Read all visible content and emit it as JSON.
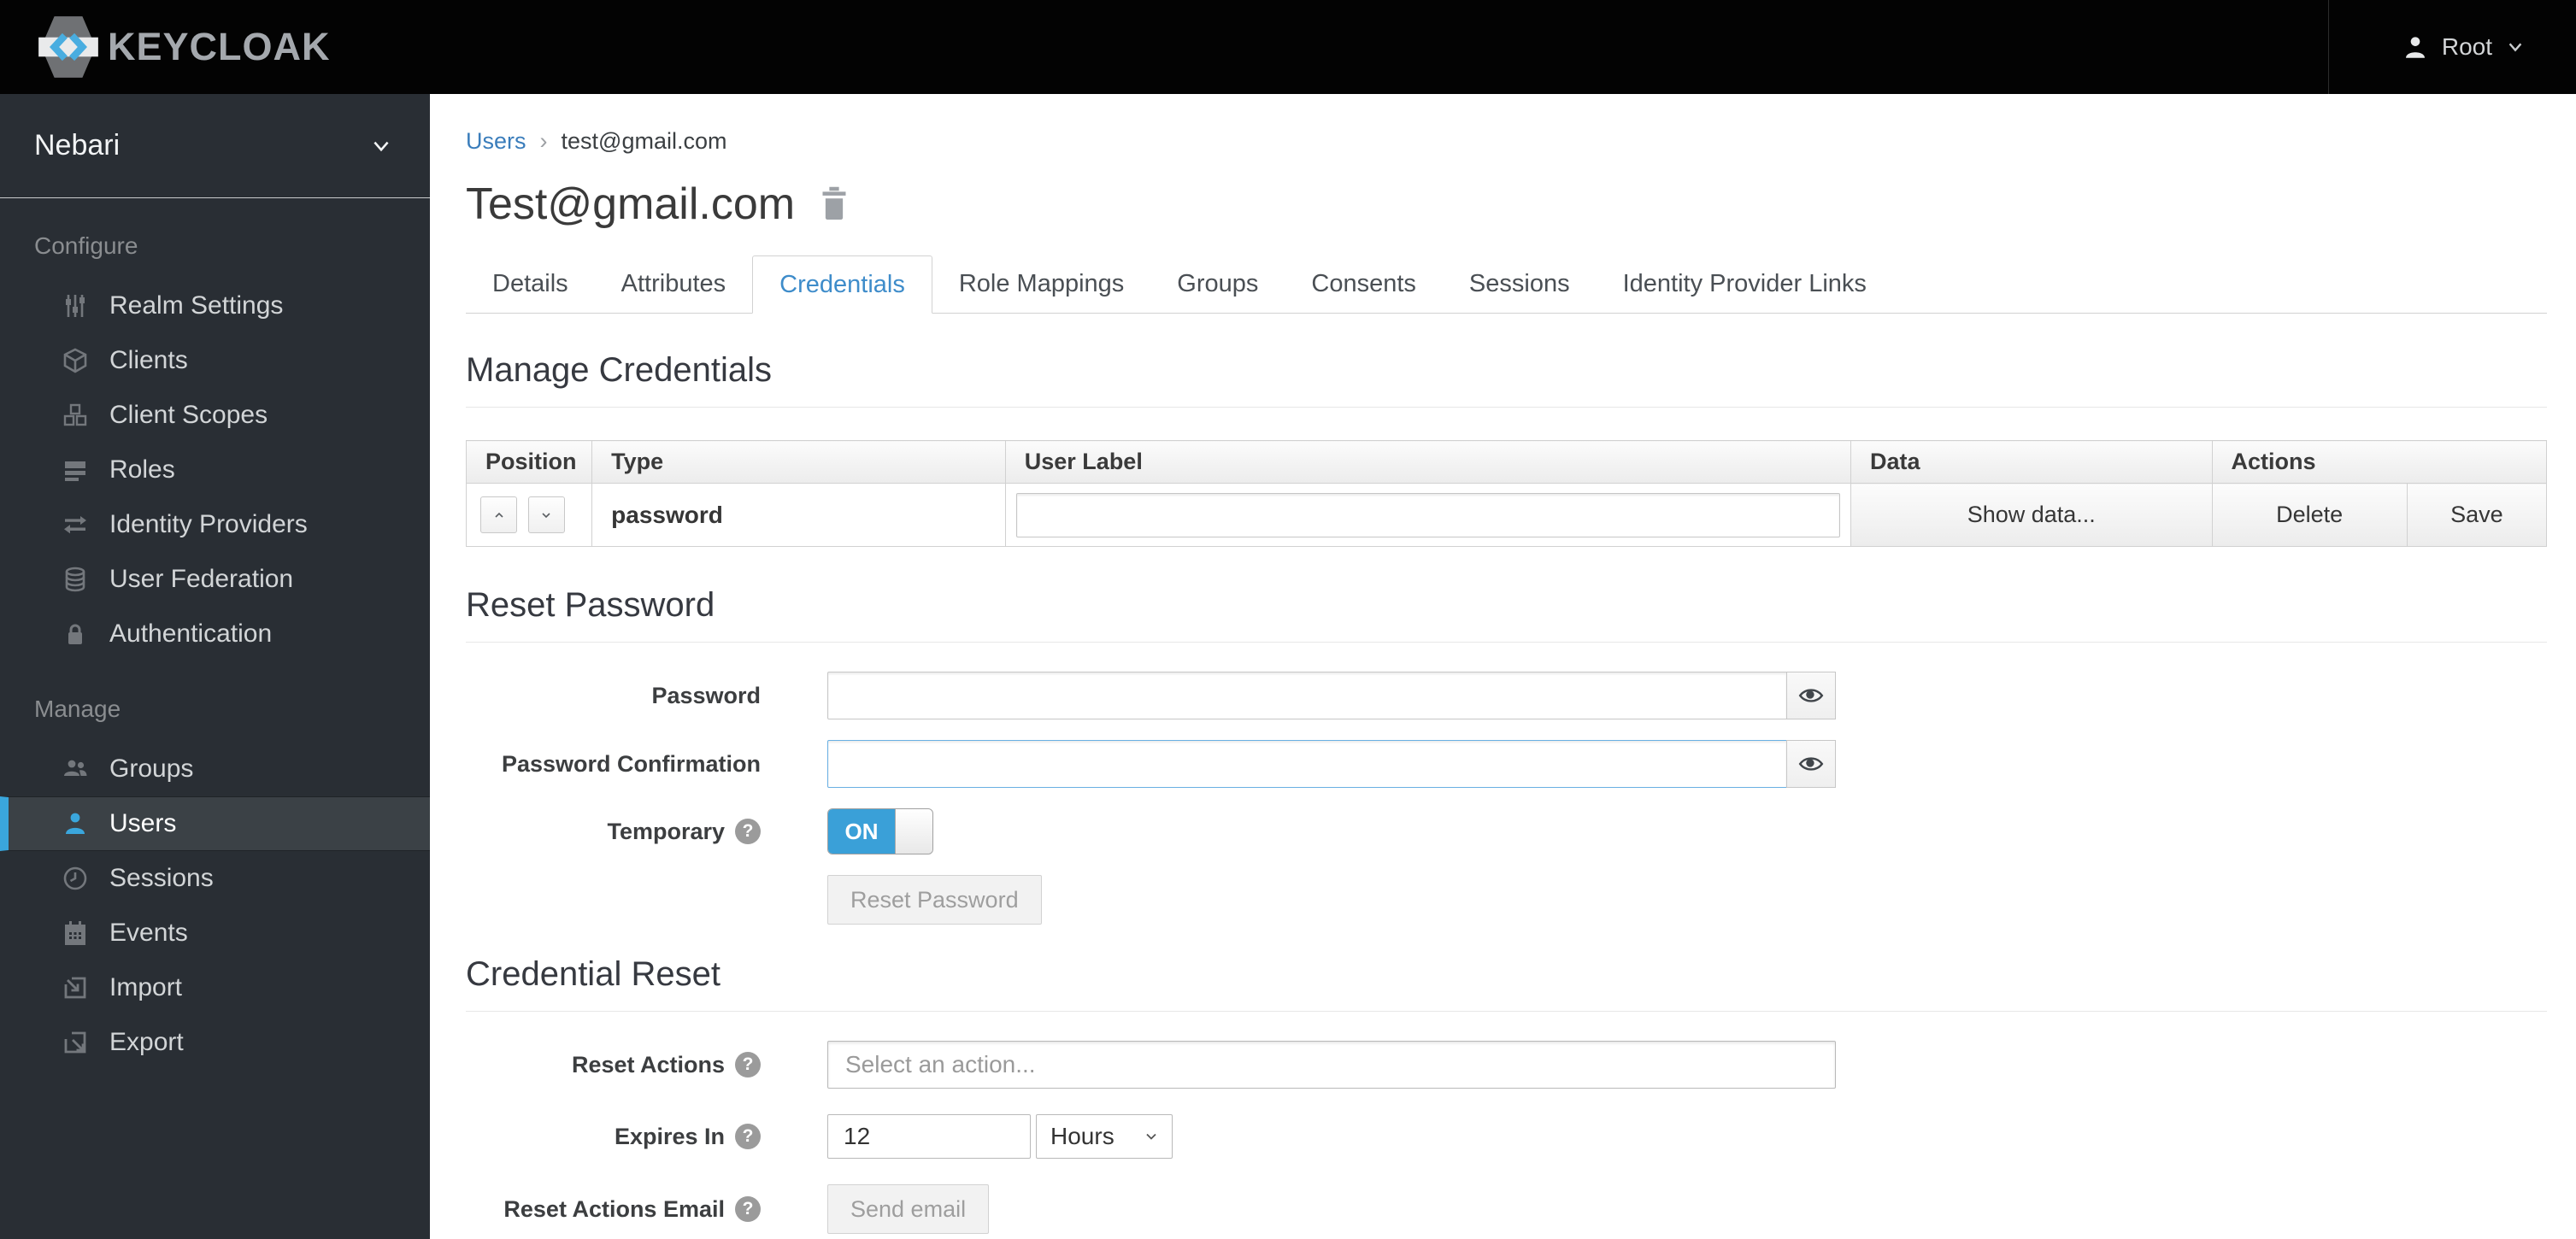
{
  "header": {
    "brand": "KEYCLOAK",
    "user": "Root"
  },
  "sidebar": {
    "realm": "Nebari",
    "sections": [
      {
        "label": "Configure",
        "items": [
          {
            "label": "Realm Settings",
            "icon": "sliders-icon"
          },
          {
            "label": "Clients",
            "icon": "cube-icon"
          },
          {
            "label": "Client Scopes",
            "icon": "cubes-icon"
          },
          {
            "label": "Roles",
            "icon": "list-icon"
          },
          {
            "label": "Identity Providers",
            "icon": "exchange-icon"
          },
          {
            "label": "User Federation",
            "icon": "database-icon"
          },
          {
            "label": "Authentication",
            "icon": "lock-icon"
          }
        ]
      },
      {
        "label": "Manage",
        "items": [
          {
            "label": "Groups",
            "icon": "groups-icon"
          },
          {
            "label": "Users",
            "icon": "user-icon",
            "active": true
          },
          {
            "label": "Sessions",
            "icon": "clock-icon"
          },
          {
            "label": "Events",
            "icon": "calendar-icon"
          },
          {
            "label": "Import",
            "icon": "import-icon"
          },
          {
            "label": "Export",
            "icon": "export-icon"
          }
        ]
      }
    ]
  },
  "breadcrumb": {
    "parent": "Users",
    "separator": "›",
    "current": "test@gmail.com"
  },
  "page": {
    "title": "Test@gmail.com"
  },
  "tabs": [
    "Details",
    "Attributes",
    "Credentials",
    "Role Mappings",
    "Groups",
    "Consents",
    "Sessions",
    "Identity Provider Links"
  ],
  "active_tab": "Credentials",
  "manage_credentials": {
    "heading": "Manage Credentials",
    "table": {
      "headers": {
        "position": "Position",
        "type": "Type",
        "user_label": "User Label",
        "data": "Data",
        "actions": "Actions"
      },
      "row": {
        "type": "password",
        "user_label_value": "",
        "data_button": "Show data...",
        "delete_button": "Delete",
        "save_button": "Save"
      }
    }
  },
  "reset_password": {
    "heading": "Reset Password",
    "password_label": "Password",
    "password_value": "",
    "confirmation_label": "Password Confirmation",
    "confirmation_value": "",
    "temporary_label": "Temporary",
    "toggle_value": "ON",
    "button": "Reset Password"
  },
  "credential_reset": {
    "heading": "Credential Reset",
    "reset_actions_label": "Reset Actions",
    "reset_actions_placeholder": "Select an action...",
    "expires_in_label": "Expires In",
    "expires_in_value": "12",
    "expires_in_unit": "Hours",
    "email_label": "Reset Actions Email",
    "send_email_button": "Send email"
  },
  "colors": {
    "accent_blue": "#3aa6dc",
    "link_blue": "#3a7dbb",
    "active_tab_blue": "#3e8cca",
    "header_bg": "#030303",
    "sidebar_bg": "#292e34",
    "sidebar_active_bg": "#3b4146",
    "toggle_on_blue": "#3aa0d8"
  }
}
